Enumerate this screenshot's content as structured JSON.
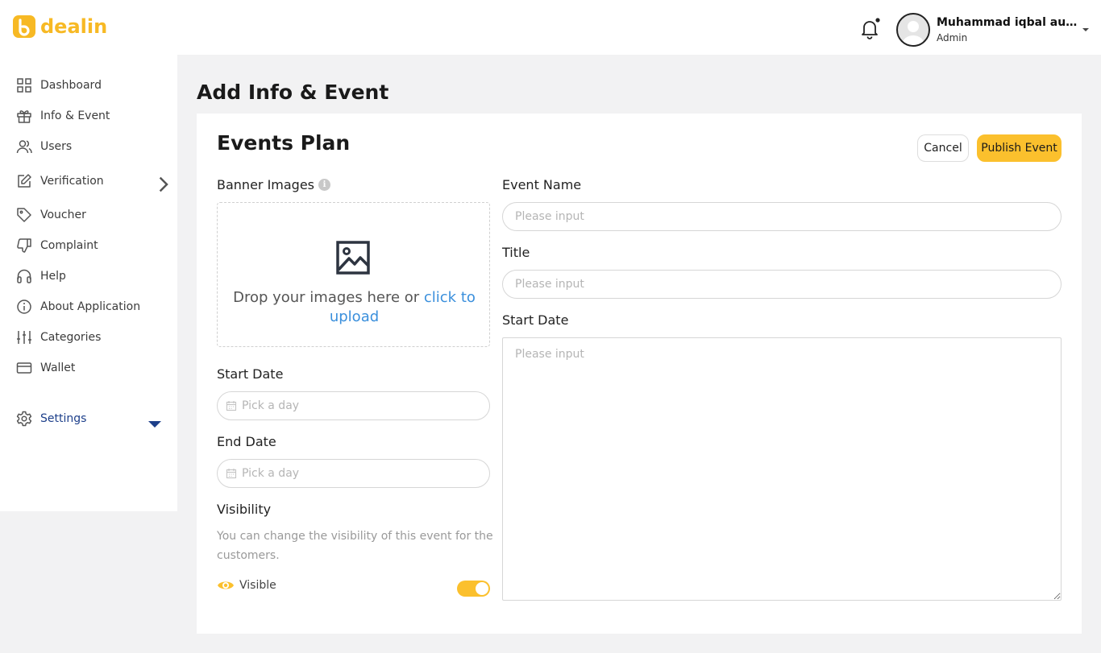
{
  "app": {
    "brand": "dealin",
    "brand_color": "#f7b924"
  },
  "header": {
    "user_name": "Muhammad iqbal aulia...",
    "user_role": "Admin",
    "notification_icon": "bell-icon",
    "has_notification_dot": true
  },
  "sidebar": {
    "items": [
      {
        "label": "Dashboard",
        "icon": "grid-icon"
      },
      {
        "label": "Info & Event",
        "icon": "gift-icon"
      },
      {
        "label": "Users",
        "icon": "users-icon"
      },
      {
        "label": "Verification",
        "icon": "edit-icon"
      },
      {
        "label": "Voucher",
        "icon": "tag-icon"
      },
      {
        "label": "Complaint",
        "icon": "thumbs-down-icon"
      },
      {
        "label": "Help",
        "icon": "headphones-icon"
      },
      {
        "label": "About Application",
        "icon": "info-icon"
      },
      {
        "label": "Categories",
        "icon": "sliders-icon"
      },
      {
        "label": "Wallet",
        "icon": "credit-card-icon"
      }
    ],
    "settings": {
      "label": "Settings",
      "icon": "gear-icon",
      "active_color": "#1d3f8a"
    }
  },
  "page": {
    "title": "Add Info & Event",
    "card_title": "Events Plan",
    "cancel_label": "Cancel",
    "publish_label": "Publish Event",
    "accent_color": "#fbc02d"
  },
  "form": {
    "banner_label": "Banner Images",
    "banner_info": "i",
    "dropzone_text": "Drop your images here or ",
    "dropzone_link": "click to upload",
    "start_date_label": "Start Date",
    "start_date_placeholder": "Pick a day",
    "end_date_label": "End Date",
    "end_date_placeholder": "Pick a day",
    "visibility_label": "Visibility",
    "visibility_desc": "You can change the visibility of this event for the customers.",
    "visible_label": "Visible",
    "visible_on": true,
    "event_name_label": "Event Name",
    "event_name_placeholder": "Please input",
    "title_label": "Title",
    "title_placeholder": "Please input",
    "description_label": "Start Date",
    "description_placeholder": "Please input"
  }
}
